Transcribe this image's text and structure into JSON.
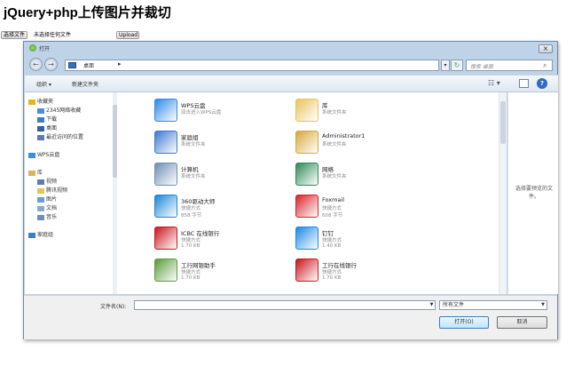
{
  "page": {
    "title": "jQuery+php上传图片并裁切",
    "choose_file_label": "选择文件",
    "file_status": "未选择任何文件",
    "upload_label": "Upload"
  },
  "dialog": {
    "title": "打开",
    "address_location": "桌面",
    "search_placeholder": "搜索 桌面",
    "toolbar": {
      "organize": "组织 ▾",
      "new_folder": "新建文件夹"
    },
    "nav": [
      {
        "label": "收藏夹",
        "icon": "star-icon",
        "color": "#e6b320",
        "indent": 0
      },
      {
        "label": "2345网络收藏",
        "icon": "link-icon",
        "color": "#4a90d9",
        "indent": 1
      },
      {
        "label": "下载",
        "icon": "download-icon",
        "color": "#3d7cc9",
        "indent": 1
      },
      {
        "label": "桌面",
        "icon": "desktop-icon",
        "color": "#2f5fa8",
        "indent": 1
      },
      {
        "label": "最近访问的位置",
        "icon": "recent-icon",
        "color": "#5a7ea8",
        "indent": 1
      },
      {
        "label": "",
        "icon": "",
        "color": "",
        "indent": 0
      },
      {
        "label": "WPS云盘",
        "icon": "cloud-icon",
        "color": "#3b8de0",
        "indent": 0
      },
      {
        "label": "",
        "icon": "",
        "color": "",
        "indent": 0
      },
      {
        "label": "库",
        "icon": "library-icon",
        "color": "#d9b35a",
        "indent": 0
      },
      {
        "label": "视频",
        "icon": "video-icon",
        "color": "#5b7fa8",
        "indent": 1
      },
      {
        "label": "腾讯视频",
        "icon": "folder-icon",
        "color": "#e6c15c",
        "indent": 1
      },
      {
        "label": "图片",
        "icon": "picture-icon",
        "color": "#6a9fd0",
        "indent": 1
      },
      {
        "label": "文档",
        "icon": "document-icon",
        "color": "#8ea9c8",
        "indent": 1
      },
      {
        "label": "音乐",
        "icon": "music-icon",
        "color": "#6f8fb6",
        "indent": 1
      },
      {
        "label": "",
        "icon": "",
        "color": "",
        "indent": 0
      },
      {
        "label": "家庭组",
        "icon": "homegroup-icon",
        "color": "#3a7bd5",
        "indent": 0
      }
    ],
    "files": [
      {
        "name": "WPS云盘",
        "line1": "双击进入WPS云盘",
        "line2": "",
        "icon": "wps-cloud-icon",
        "color": "#2f8ae6"
      },
      {
        "name": "库",
        "line1": "系统文件夹",
        "line2": "",
        "icon": "library-folder-icon",
        "color": "#e8c45c"
      },
      {
        "name": "家庭组",
        "line1": "系统文件夹",
        "line2": "",
        "icon": "homegroup-icon",
        "color": "#3c7ad0"
      },
      {
        "name": "Administrator1",
        "line1": "系统文件夹",
        "line2": "",
        "icon": "user-folder-icon",
        "color": "#d6a93a"
      },
      {
        "name": "计算机",
        "line1": "系统文件夹",
        "line2": "",
        "icon": "computer-icon",
        "color": "#6d8fb5"
      },
      {
        "name": "网络",
        "line1": "系统文件夹",
        "line2": "",
        "icon": "network-icon",
        "color": "#2e8b57"
      },
      {
        "name": "360驱动大师",
        "line1": "快捷方式",
        "line2": "858 字节",
        "icon": "driver-master-icon",
        "color": "#1c86d6"
      },
      {
        "name": "Foxmail",
        "line1": "快捷方式",
        "line2": "608 字节",
        "icon": "foxmail-icon",
        "color": "#d8232a"
      },
      {
        "name": "ICBC 在线银行",
        "line1": "快捷方式",
        "line2": "1.70 KB",
        "icon": "icbc-icon",
        "color": "#c9151e"
      },
      {
        "name": "钉钉",
        "line1": "快捷方式",
        "line2": "1.40 KB",
        "icon": "dingtalk-icon",
        "color": "#1e88e5"
      },
      {
        "name": "工行网银助手",
        "line1": "快捷方式",
        "line2": "1.70 KB",
        "icon": "icbc-assistant-icon",
        "color": "#5a9a3c"
      },
      {
        "name": "工行在线银行",
        "line1": "快捷方式",
        "line2": "1.70 KB",
        "icon": "icbc-bank-icon",
        "color": "#c9151e"
      }
    ],
    "preview_text": "选择要预览的文件。",
    "filename_label": "文件名(N):",
    "filetype": "所有文件",
    "open_label": "打开(O)",
    "cancel_label": "取消"
  }
}
